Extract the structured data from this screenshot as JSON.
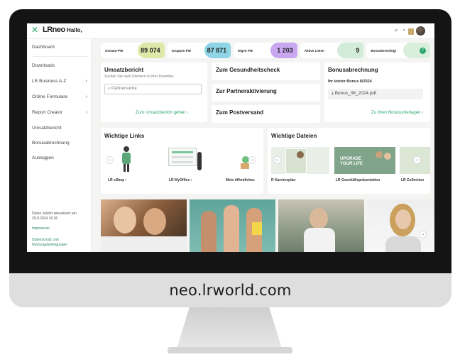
{
  "header": {
    "logo": "LRneo",
    "greeting": "Hallo,"
  },
  "sidebar": {
    "items": [
      {
        "label": "Dashboard"
      },
      {
        "label": "Downloads"
      },
      {
        "label": "LR Business A-Z",
        "chevron": true
      },
      {
        "label": "Online Formulare",
        "chevron": true
      },
      {
        "label": "Report Creator",
        "chevron": true
      },
      {
        "label": "Umsatzbericht"
      },
      {
        "label": "Bonusabrechnung"
      },
      {
        "label": "Ausloggen"
      }
    ],
    "footer": {
      "updated": "Daten zuletzt aktualisiert am 29.8.2024 16:26",
      "impressum": "Impressum",
      "privacy": "Datenschutz und Nutzungsbedingungen"
    }
  },
  "kpis": [
    {
      "label": "Gesamt-PW",
      "value": "89 074",
      "color": "#dfe8a8"
    },
    {
      "label": "Gruppen PW",
      "value": "87 871",
      "color": "#8fd5e6"
    },
    {
      "label": "Eigen PW",
      "value": "1 203",
      "color": "#c9a7f0"
    },
    {
      "label": "Aktive Listen",
      "value": "9",
      "color": "#d3ecd9"
    },
    {
      "label": "Bonusberechtigt",
      "value": "",
      "color": "#d9efdc"
    }
  ],
  "umsatz": {
    "title": "Umsatzbericht",
    "subtitle": "Suchen Sie nach Partnern in Ihrer Downline.",
    "search_placeholder": "Partnersuche",
    "link": "Zum Umsatzbericht gehen"
  },
  "actions": [
    {
      "label": "Zum Gesundheitscheck"
    },
    {
      "label": "Zur Partneraktivierung"
    },
    {
      "label": "Zum Postversand"
    }
  ],
  "bonus": {
    "title": "Bonusabrechnung",
    "last": "Ihr letzter Bonus 8/2024",
    "file": "Bonus_08_2024.pdf",
    "link": "Zu Ihren Bonusunterlagen"
  },
  "links": {
    "title": "Wichtige Links",
    "items": [
      {
        "label": "LR eShop"
      },
      {
        "label": "LR MyOffice"
      },
      {
        "label": "Mein öffentliches"
      }
    ]
  },
  "files": {
    "title": "Wichtige Dateien",
    "items": [
      {
        "label": "R Karriereplan"
      },
      {
        "label": "LR Geschäftspräsentation"
      },
      {
        "label": "LR Collection"
      }
    ],
    "thumb_text": "UPGRADE YOUR LIFE"
  },
  "footer_url": "neo.lrworld.com"
}
